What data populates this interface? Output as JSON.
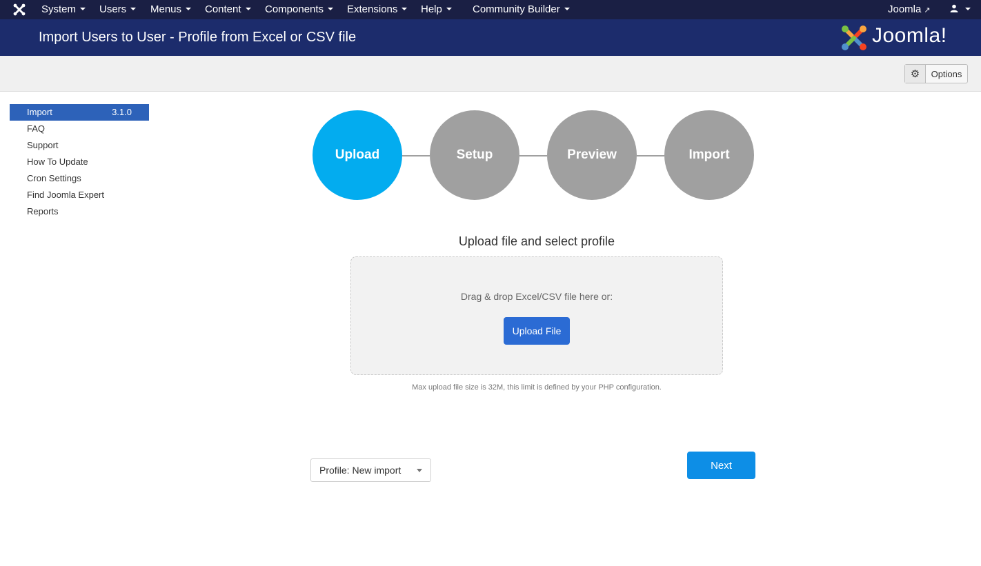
{
  "topnav": {
    "items": [
      {
        "label": "System"
      },
      {
        "label": "Users"
      },
      {
        "label": "Menus"
      },
      {
        "label": "Content"
      },
      {
        "label": "Components"
      },
      {
        "label": "Extensions"
      },
      {
        "label": "Help"
      },
      {
        "label": "Community Builder"
      }
    ],
    "site_link": "Joomla",
    "user_icon": "user-icon"
  },
  "header": {
    "title": "Import Users to User - Profile from Excel or CSV file",
    "logo_text": "Joomla!"
  },
  "toolbar": {
    "options_label": "Options",
    "options_icon": "gear-icon"
  },
  "sidebar": {
    "items": [
      {
        "label": "Import",
        "version": "3.1.0",
        "active": true
      },
      {
        "label": "FAQ"
      },
      {
        "label": "Support"
      },
      {
        "label": "How To Update"
      },
      {
        "label": "Cron Settings"
      },
      {
        "label": "Find Joomla Expert"
      },
      {
        "label": "Reports"
      }
    ]
  },
  "steps": [
    {
      "label": "Upload",
      "active": true
    },
    {
      "label": "Setup"
    },
    {
      "label": "Preview"
    },
    {
      "label": "Import"
    }
  ],
  "upload": {
    "heading": "Upload file and select profile",
    "hint": "Drag & drop Excel/CSV file here or:",
    "button_label": "Upload File",
    "max_size_note": "Max upload file size is 32M, this limit is defined by your PHP configuration."
  },
  "profile_select": {
    "selected": "Profile: New import"
  },
  "next_label": "Next",
  "colors": {
    "navbar": "#1a1f44",
    "header": "#1c2c6c",
    "step_active": "#03acef",
    "step_inactive": "#a0a0a0",
    "sidebar_active": "#2d62b9",
    "upload_button": "#2b6bd4",
    "next_button": "#0d8ee6"
  }
}
